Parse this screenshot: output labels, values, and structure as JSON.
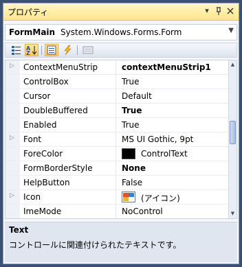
{
  "window": {
    "title": "プロパティ"
  },
  "titlebar_buttons": [
    "chevron-down-icon",
    "pin-icon",
    "close-icon"
  ],
  "selector": {
    "name": "FormMain",
    "type": "System.Windows.Forms.Form"
  },
  "toolbar": [
    "categorized-icon",
    "alphabetical-icon",
    "properties-icon",
    "events-icon",
    "property-pages-icon"
  ],
  "properties": [
    {
      "name": "ContextMenuStrip",
      "value": "contextMenuStrip1",
      "bold": true,
      "expandable": true
    },
    {
      "name": "ControlBox",
      "value": "True"
    },
    {
      "name": "Cursor",
      "value": "Default"
    },
    {
      "name": "DoubleBuffered",
      "value": "True",
      "bold": true
    },
    {
      "name": "Enabled",
      "value": "True"
    },
    {
      "name": "Font",
      "value": "MS UI Gothic, 9pt",
      "expandable": true
    },
    {
      "name": "ForeColor",
      "value": "ControlText",
      "swatch": "#000000"
    },
    {
      "name": "FormBorderStyle",
      "value": "None",
      "bold": true
    },
    {
      "name": "HelpButton",
      "value": "False"
    },
    {
      "name": "Icon",
      "value": "(アイコン)",
      "expandable": true,
      "icon": true
    },
    {
      "name": "ImeMode",
      "value": "NoControl"
    }
  ],
  "description": {
    "title": "Text",
    "text": "コントロールに関連付けられたテキストです。"
  },
  "colors": {
    "frame": "#3b5072",
    "titlebar": "#ffe58a",
    "selected_tool": "#ffcc5e"
  }
}
